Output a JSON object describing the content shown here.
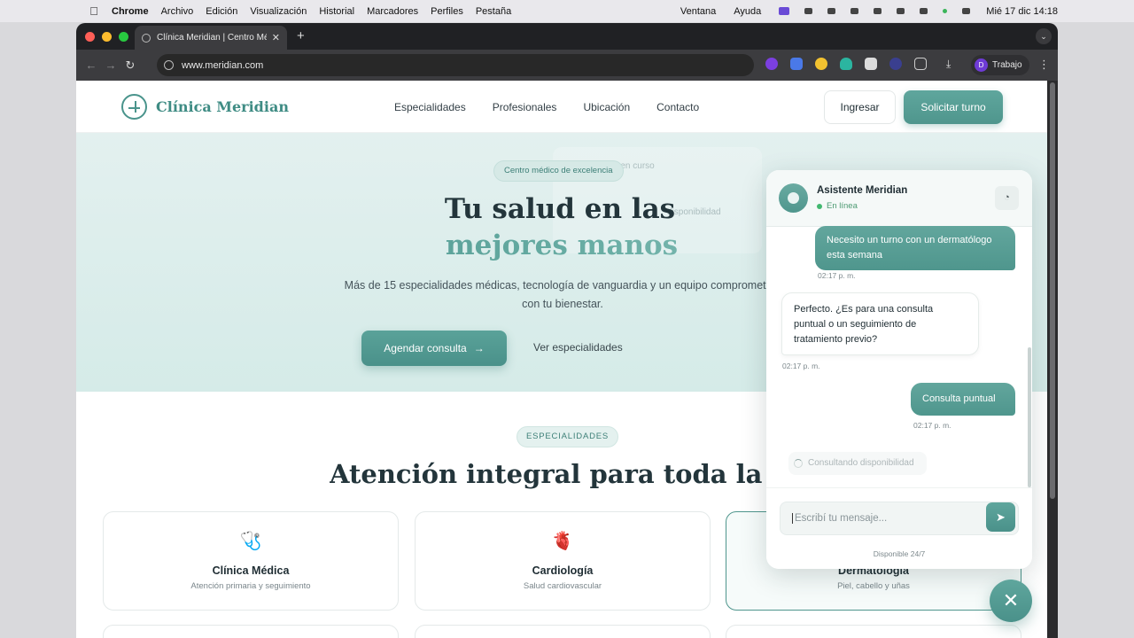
{
  "os_menu": {
    "app": "Chrome",
    "items": [
      "Archivo",
      "Edición",
      "Visualización",
      "Historial",
      "Marcadores",
      "Perfiles",
      "Pestaña"
    ],
    "right_items": [
      "Ventana",
      "Ayuda"
    ],
    "clock": "Mié 17 dic 14:18"
  },
  "browser": {
    "tab_title": "Clínica Meridian | Centro Médico",
    "url": "www.meridian.com",
    "profile_initial": "D",
    "profile_name": "Trabajo"
  },
  "site": {
    "brand": "Clínica Meridian",
    "nav": [
      "Especialidades",
      "Profesionales",
      "Ubicación",
      "Contacto"
    ],
    "login_label": "Ingresar",
    "cta_label": "Solicitar turno"
  },
  "hero": {
    "badge": "Centro médico de excelencia",
    "title_line1": "Tu salud en las",
    "title_line2": "mejores manos",
    "subtitle": "Más de 15 especialidades médicas, tecnología de vanguardia y un equipo comprometido con tu bienestar.",
    "primary_btn": "Agendar consulta",
    "secondary_btn": "Ver especialidades",
    "ghost_actions": "Acciones en curso",
    "ghost_availability": "disponibilidad"
  },
  "specialties": {
    "badge": "ESPECIALIDADES",
    "title": "Atención integral para toda la familia",
    "cards": [
      {
        "icon": "stethoscope-icon",
        "glyph": "🩺",
        "name": "Clínica Médica",
        "desc": "Atención primaria y seguimiento"
      },
      {
        "icon": "heart-icon",
        "glyph": "🫀",
        "name": "Cardiología",
        "desc": "Salud cardiovascular"
      },
      {
        "icon": "dermatology-icon",
        "glyph": "",
        "name": "Dermatología",
        "desc": "Piel, cabello y uñas"
      }
    ]
  },
  "chat": {
    "name": "Asistente Meridian",
    "status": "En línea",
    "messages": [
      {
        "from": "user",
        "text": "Necesito un turno con un dermatólogo esta semana",
        "time": "02:17 p. m."
      },
      {
        "from": "bot",
        "text": "Perfecto. ¿Es para una consulta puntual o un seguimiento de tratamiento previo?",
        "time": "02:17 p. m."
      },
      {
        "from": "user",
        "text": "Consulta puntual",
        "time": "02:17 p. m."
      }
    ],
    "typing": "Consultando disponibilidad",
    "input_placeholder": "Escribí tu mensaje...",
    "footer": "Disponible 24/7"
  },
  "colors": {
    "accent": "#4f968d",
    "online": "#42b870"
  }
}
